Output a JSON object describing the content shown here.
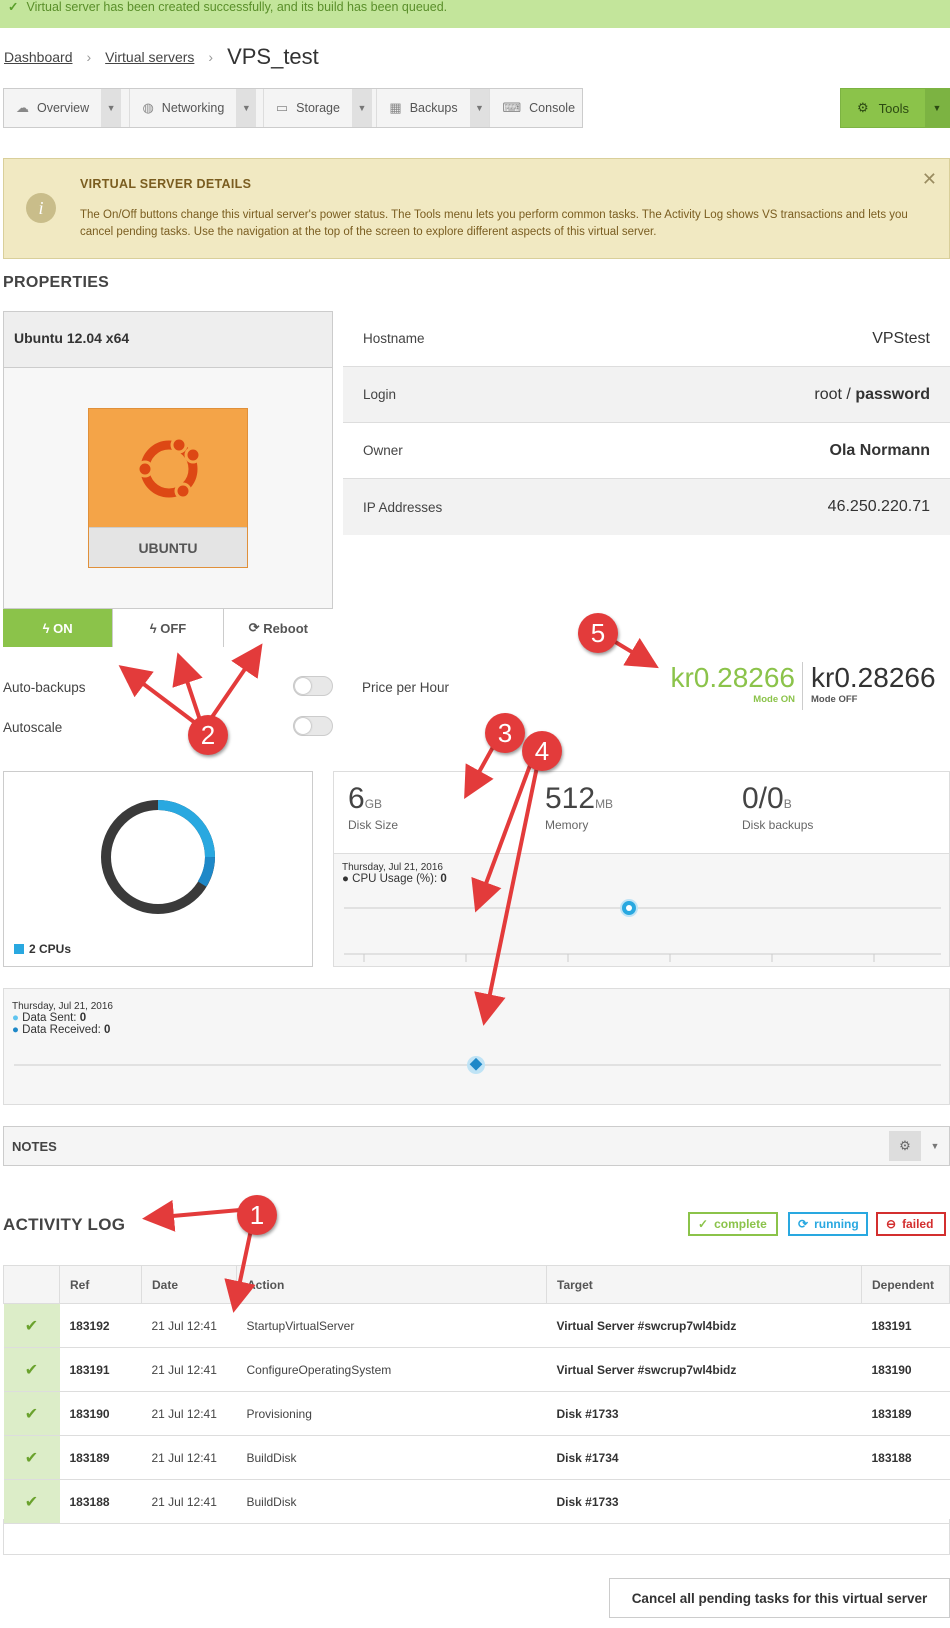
{
  "flash": {
    "message": "Virtual server has been created successfully, and its build has been queued."
  },
  "breadcrumb": {
    "dashboard": "Dashboard",
    "servers": "Virtual servers",
    "current": "VPS_test"
  },
  "tabs": [
    {
      "label": "Overview"
    },
    {
      "label": "Networking"
    },
    {
      "label": "Storage"
    },
    {
      "label": "Backups"
    },
    {
      "label": "Console"
    }
  ],
  "tools": {
    "label": "Tools"
  },
  "notice": {
    "title": "VIRTUAL SERVER DETAILS",
    "text": "The On/Off buttons change this virtual server's power status. The Tools menu lets you perform common tasks. The Activity Log shows VS transactions and lets you cancel pending tasks. Use the navigation at the top of the screen to explore different aspects of this virtual server."
  },
  "properties": {
    "heading": "PROPERTIES",
    "os_title": "Ubuntu 12.04 x64",
    "os_logo": "UBUNTU",
    "power": {
      "on": "ON",
      "off": "OFF",
      "reboot": "Reboot"
    },
    "rows": [
      {
        "k": "Hostname",
        "v": "VPStest"
      },
      {
        "k": "Login",
        "v1": "root",
        "sep": " / ",
        "v2": "password"
      },
      {
        "k": "Owner",
        "v": "Ola Normann"
      },
      {
        "k": "IP Addresses",
        "v": "46.250.220.71"
      }
    ],
    "auto_backups": "Auto-backups",
    "autoscale": "Autoscale",
    "price_label": "Price per Hour",
    "price_on": "kr0.28266",
    "price_on_mode": "Mode ON",
    "price_off": "kr0.28266",
    "price_off_mode": "Mode OFF"
  },
  "cpu": {
    "legend": "2 CPUs"
  },
  "stats": {
    "disk": {
      "value": "6",
      "unit": "GB",
      "label": "Disk Size"
    },
    "memory": {
      "value": "512",
      "unit": "MB",
      "label": "Memory"
    },
    "backups": {
      "value": "0/0",
      "unit": "B",
      "label": "Disk backups"
    }
  },
  "cpu_chart": {
    "date": "Thursday, Jul 21, 2016",
    "series": "CPU Usage (%):",
    "value": "0"
  },
  "net_chart": {
    "date": "Thursday, Jul 21, 2016",
    "sent": "Data Sent:",
    "sent_v": "0",
    "recv": "Data Received:",
    "recv_v": "0"
  },
  "notes": {
    "title": "NOTES"
  },
  "activity": {
    "heading": "ACTIVITY LOG",
    "complete": "complete",
    "running": "running",
    "failed": "failed",
    "columns": [
      "Ref",
      "Date",
      "Action",
      "Target",
      "Dependent"
    ],
    "rows": [
      {
        "ref": "183192",
        "date": "21 Jul 12:41",
        "action": "StartupVirtualServer",
        "target": "Virtual Server #swcrup7wl4bidz",
        "dep": "183191"
      },
      {
        "ref": "183191",
        "date": "21 Jul 12:41",
        "action": "ConfigureOperatingSystem",
        "target": "Virtual Server #swcrup7wl4bidz",
        "dep": "183190"
      },
      {
        "ref": "183190",
        "date": "21 Jul 12:41",
        "action": "Provisioning",
        "target": "Disk #1733",
        "dep": "183189"
      },
      {
        "ref": "183189",
        "date": "21 Jul 12:41",
        "action": "BuildDisk",
        "target": "Disk #1734",
        "dep": "183188"
      },
      {
        "ref": "183188",
        "date": "21 Jul 12:41",
        "action": "BuildDisk",
        "target": "Disk #1733",
        "dep": ""
      }
    ]
  },
  "cancel": {
    "label": "Cancel all pending tasks for this virtual server"
  },
  "callouts": [
    "1",
    "2",
    "3",
    "4",
    "5"
  ]
}
